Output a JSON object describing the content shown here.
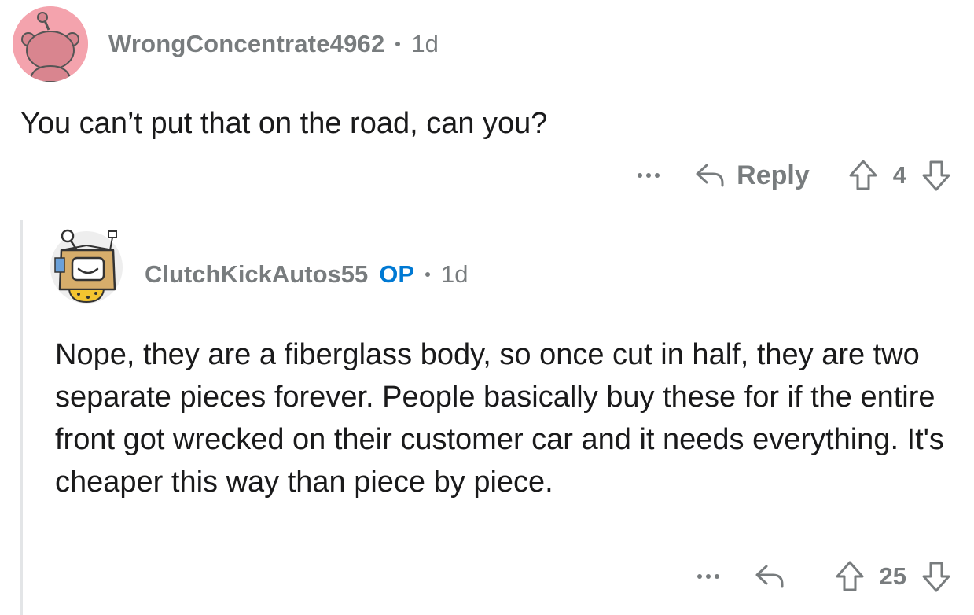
{
  "comment": {
    "username": "WrongConcentrate4962",
    "age": "1d",
    "body": "You can’t put that on the road, can you?",
    "reply_label": "Reply",
    "score": "4",
    "colors": {
      "avatar_bg": "#f4a3ad",
      "meta": "#787c7e",
      "text": "#1a1a1b"
    }
  },
  "reply": {
    "username": "ClutchKickAutos55",
    "op_label": "OP",
    "age": "1d",
    "body": "Nope, they are a fiberglass body, so once cut in half, they are two separate pieces forever. People basically buy these for if the entire front got wrecked on their customer car and it needs everything. It's cheaper this way than piece by piece.",
    "score": "25",
    "colors": {
      "op": "#0079d3",
      "thread_line": "#e3e5e7"
    }
  },
  "icons": {
    "more": "more-options-icon",
    "reply": "reply-arrow-icon",
    "upvote": "upvote-arrow-icon",
    "downvote": "downvote-arrow-icon"
  }
}
